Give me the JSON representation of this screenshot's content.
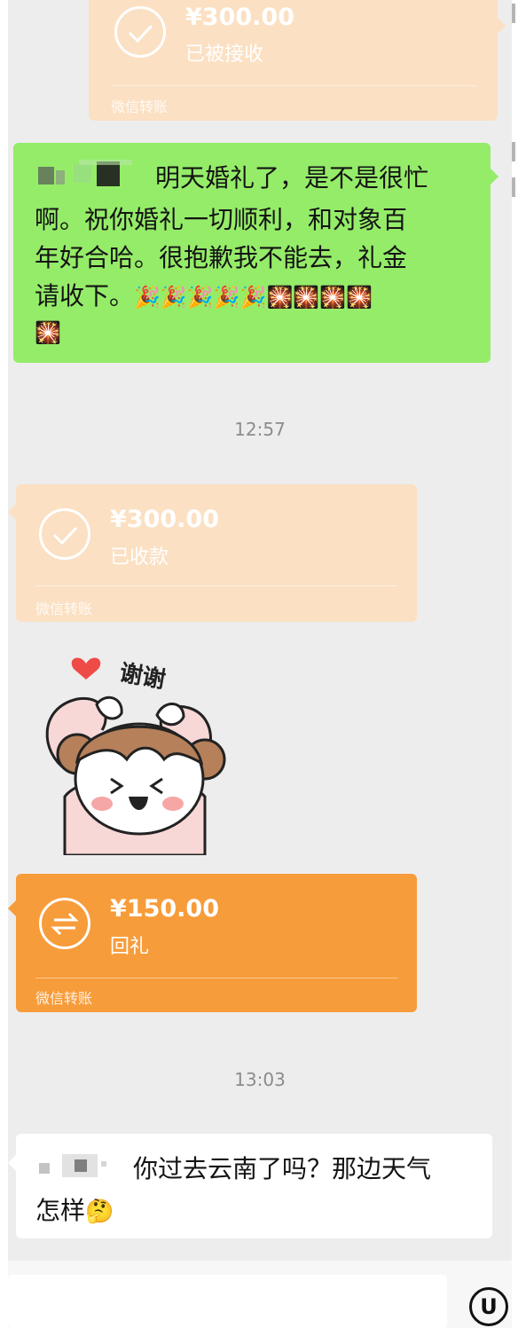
{
  "messages": {
    "transfer_top": {
      "amount": "¥300.00",
      "status": "已被接收",
      "footer": "微信转账"
    },
    "green_message": {
      "text_line1": "明天婚礼了，是不是很忙",
      "text_line2": "啊。祝你婚礼一切顺利，和对象百",
      "text_line3": "年好合哈。很抱歉我不能去，礼金",
      "text_line4": "请收下。",
      "emojis_party": "🎉🎉🎉🎉🎉",
      "emojis_fireworks": "🎇🎇🎇🎇",
      "emoji_last": "🎇"
    },
    "time1": "12:57",
    "transfer_received": {
      "amount": "¥300.00",
      "status": "已收款",
      "footer": "微信转账"
    },
    "sticker": {
      "text": "谢谢"
    },
    "transfer_return": {
      "amount": "¥150.00",
      "status": "回礼",
      "footer": "微信转账"
    },
    "time2": "13:03",
    "white_message": {
      "text_line1": "你过去云南了吗？那边天气",
      "text_line2": "怎样",
      "emoji": "🤔"
    }
  },
  "input_bar": {
    "voice_icon": "U"
  },
  "colors": {
    "chat_bg": "#ededed",
    "green_bubble": "#95ec69",
    "received_card": "#fbe0c3",
    "active_card": "#f79c3a"
  }
}
